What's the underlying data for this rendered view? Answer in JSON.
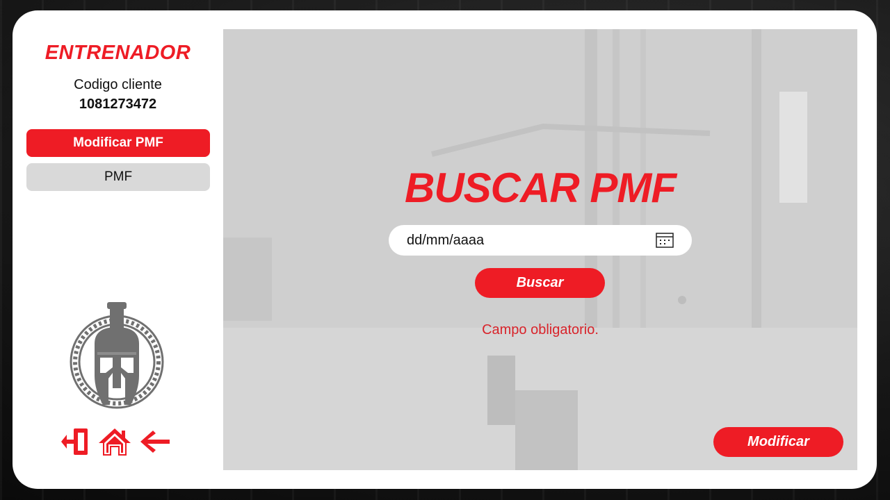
{
  "sidebar": {
    "brand": "ENTRENADOR",
    "client_label": "Codigo cliente",
    "client_code": "1081273472",
    "nav": [
      {
        "label": "Modificar PMF",
        "active": true
      },
      {
        "label": "PMF",
        "active": false
      }
    ],
    "footer_icons": [
      "logout-icon",
      "home-icon",
      "back-arrow-icon"
    ]
  },
  "main": {
    "title": "BUSCAR PMF",
    "date_input": {
      "placeholder": "dd/mm/aaaa",
      "icon": "calendar-icon"
    },
    "search_label": "Buscar",
    "error": "Campo obligatorio.",
    "modify_label": "Modificar"
  },
  "colors": {
    "accent": "#ee1c25",
    "inactive_nav": "#d9d9d9",
    "panel_bg": "#d0d0d0",
    "logo_gray": "#707070"
  }
}
